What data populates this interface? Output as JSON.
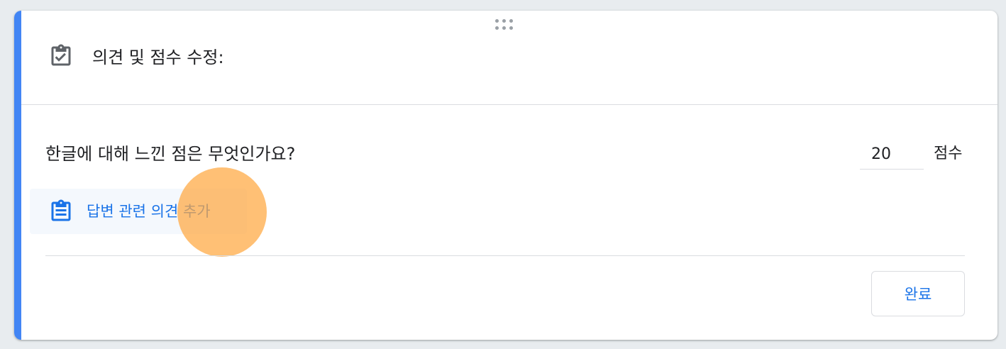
{
  "card": {
    "title": "의견 및 점수 수정:",
    "accent_color": "#4285f4",
    "title_icon": "assignment-turned-in-icon"
  },
  "question": {
    "text": "한글에 대해 느낀 점은 무엇인가요?",
    "score_value": "20",
    "score_unit": "점수"
  },
  "feedback": {
    "add_label": "답변 관련 의견 추가",
    "icon": "assignment-icon"
  },
  "footer": {
    "done_label": "완료"
  }
}
